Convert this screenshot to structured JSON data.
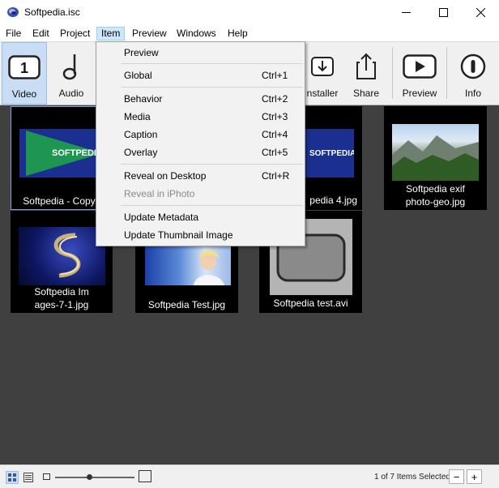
{
  "window": {
    "title": "Softpedia.isc",
    "app_icon": "iscripts-swirl-icon"
  },
  "menubar": {
    "items": [
      {
        "label": "File"
      },
      {
        "label": "Edit"
      },
      {
        "label": "Project"
      },
      {
        "label": "Item",
        "active": true
      },
      {
        "label": "Preview"
      },
      {
        "label": "Windows"
      },
      {
        "label": "Help"
      }
    ]
  },
  "toolbar": {
    "buttons": [
      {
        "label": "Video",
        "icon": "number-one-icon",
        "selected": true
      },
      {
        "label": "Audio",
        "icon": "music-note-icon"
      },
      {
        "label": "Installer",
        "icon": "download-tray-icon"
      },
      {
        "label": "Share",
        "icon": "share-icon"
      },
      {
        "label": "Preview",
        "icon": "play-icon"
      },
      {
        "label": "Info",
        "icon": "info-icon"
      }
    ],
    "installer_visible_label": "nstaller"
  },
  "item_menu": {
    "items": [
      {
        "label": "Preview",
        "shortcut": ""
      },
      {
        "label": "Global",
        "shortcut": "Ctrl+1"
      },
      {
        "label": "Behavior",
        "shortcut": "Ctrl+2"
      },
      {
        "label": "Media",
        "shortcut": "Ctrl+3"
      },
      {
        "label": "Caption",
        "shortcut": "Ctrl+4"
      },
      {
        "label": "Overlay",
        "shortcut": "Ctrl+5"
      },
      {
        "label": "Reveal on Desktop",
        "shortcut": "Ctrl+R"
      },
      {
        "label": "Reveal in iPhoto",
        "shortcut": "",
        "disabled": true
      },
      {
        "label": "Update Metadata",
        "shortcut": ""
      },
      {
        "label": "Update Thumbnail Image",
        "shortcut": ""
      }
    ]
  },
  "items": [
    {
      "caption": "Softpedia - CopyJ",
      "selected": true,
      "logo": "SOFTPEDIA"
    },
    {
      "caption": "pedia 4.jpg",
      "logo": "SOFTPEDIA"
    },
    {
      "caption_line1": "Softpedia exif",
      "caption_line2": "photo-geo.jpg"
    },
    {
      "caption_line1": "Softpedia Im",
      "caption_line2": "ages-7-1.jpg"
    },
    {
      "caption": "Softpedia Test.jpg"
    },
    {
      "caption": "Softpedia test.avi"
    }
  ],
  "statusbar": {
    "status": "1 of 7 Items Selected",
    "zoom_slider_fraction": 0.4,
    "minus_label": "−",
    "plus_label": "+"
  },
  "colors": {
    "accent_selected": "#c9def5",
    "content_bg": "#404040",
    "softpedia_blue": "#1a2f8f",
    "play_green": "#1fa14a"
  }
}
